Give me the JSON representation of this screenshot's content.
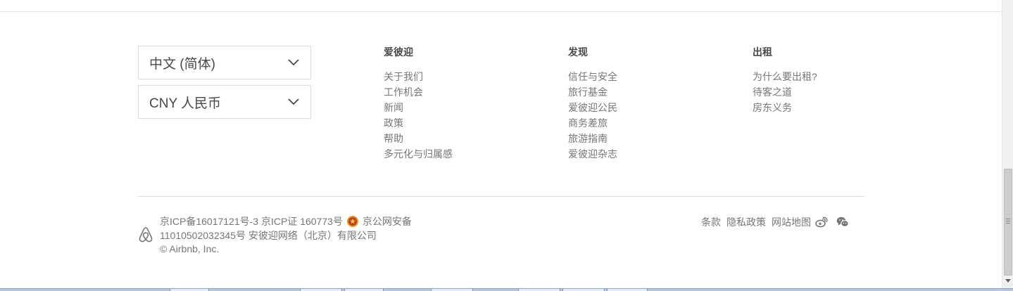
{
  "selectors": {
    "language": "中文 (简体)",
    "currency": "CNY 人民币"
  },
  "columns": [
    {
      "title": "爱彼迎",
      "links": [
        "关于我们",
        "工作机会",
        "新闻",
        "政策",
        "帮助",
        "多元化与归属感"
      ]
    },
    {
      "title": "发现",
      "links": [
        "信任与安全",
        "旅行基金",
        "爱彼迎公民",
        "商务差旅",
        "旅游指南",
        "爱彼迎杂志"
      ]
    },
    {
      "title": "出租",
      "links": [
        "为什么要出租?",
        "待客之道",
        "房东义务"
      ]
    }
  ],
  "legal": {
    "icp_record": "京ICP备16017121号-3",
    "icp_cert": "京ICP证 160773号",
    "police_prefix": "京公网安备",
    "police_number": "11010502032345号",
    "company": "安彼迎网络（北京）有限公司",
    "copyright": "© Airbnb, Inc."
  },
  "footer_links": {
    "terms": "条款",
    "privacy": "隐私政策",
    "sitemap": "网站地图"
  },
  "icons": {
    "logo": "airbnb-belo-icon",
    "police": "police-badge-icon",
    "weibo": "weibo-icon",
    "wechat": "wechat-icon",
    "chevron": "chevron-down-icon"
  },
  "colors": {
    "text_primary": "#484848",
    "text_secondary": "#767676",
    "divider": "#dcdcdc"
  }
}
